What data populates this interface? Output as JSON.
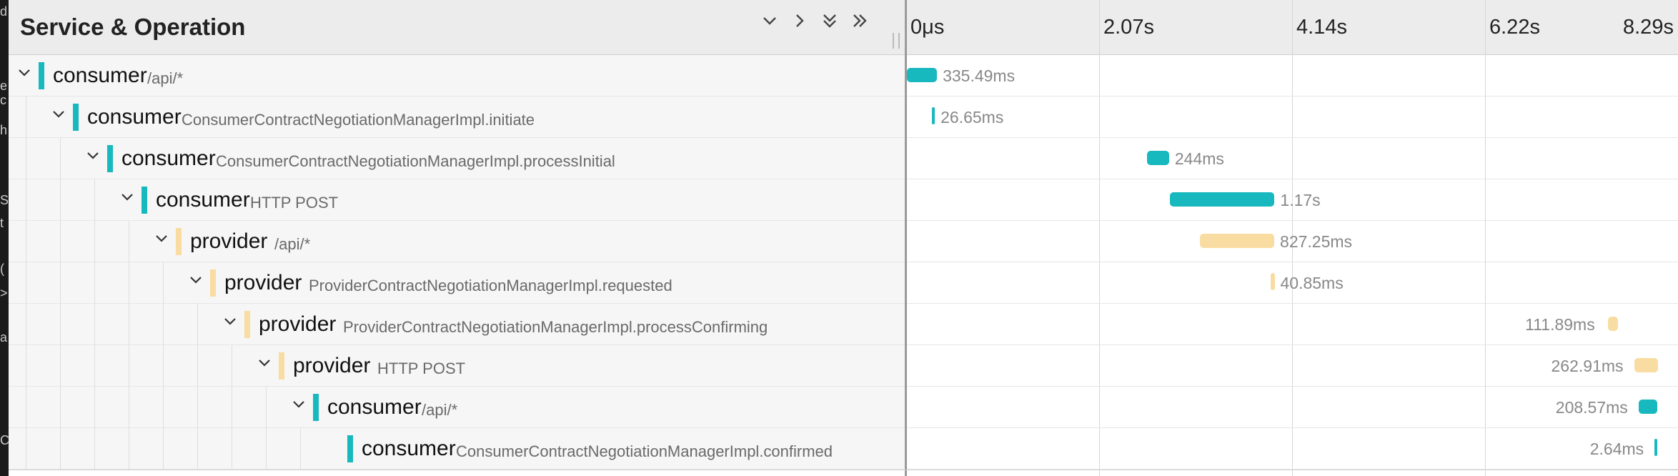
{
  "colors": {
    "consumer": "#17b8be",
    "provider": "#f8dca1",
    "header_bg": "#ececec"
  },
  "left_strip_glyphs": [
    "d",
    "e",
    "c",
    "h",
    "S",
    "t",
    "(",
    ">",
    "a",
    "C"
  ],
  "header": {
    "title": "Service & Operation",
    "controls": [
      {
        "name": "collapse-one-icon",
        "glyph": "⌄"
      },
      {
        "name": "expand-one-icon",
        "glyph": "›"
      },
      {
        "name": "expand-all-icon",
        "glyph": "⌄⌄"
      },
      {
        "name": "collapse-all-icon",
        "glyph": "»"
      }
    ]
  },
  "timeline": {
    "ticks": [
      "0μs",
      "2.07s",
      "4.14s",
      "6.22s",
      "8.29s"
    ],
    "max_seconds": 8.6
  },
  "spans": [
    {
      "service": "consumer",
      "operation": "/api/*",
      "depth": 0,
      "start_s": 0.0,
      "duration_s": 0.33549,
      "duration_label": "335.49ms",
      "expanded": true
    },
    {
      "service": "consumer",
      "operation": "ConsumerContractNegotiationManagerImpl.initiate",
      "depth": 1,
      "start_s": 0.28,
      "duration_s": 0.02665,
      "duration_label": "26.65ms",
      "expanded": true
    },
    {
      "service": "consumer",
      "operation": "ConsumerContractNegotiationManagerImpl.processInitial",
      "depth": 2,
      "start_s": 2.68,
      "duration_s": 0.244,
      "duration_label": "244ms",
      "expanded": true
    },
    {
      "service": "consumer",
      "operation": "HTTP POST",
      "depth": 3,
      "start_s": 2.93,
      "duration_s": 1.17,
      "duration_label": "1.17s",
      "expanded": true
    },
    {
      "service": "provider",
      "operation": "/api/*",
      "depth": 4,
      "start_s": 3.27,
      "duration_s": 0.82725,
      "duration_label": "827.25ms",
      "expanded": true
    },
    {
      "service": "provider",
      "operation": "ProviderContractNegotiationManagerImpl.requested",
      "depth": 5,
      "start_s": 4.06,
      "duration_s": 0.04085,
      "duration_label": "40.85ms",
      "expanded": true
    },
    {
      "service": "provider",
      "operation": "ProviderContractNegotiationManagerImpl.processConfirming",
      "depth": 6,
      "start_s": 7.82,
      "duration_s": 0.11189,
      "duration_label": "111.89ms",
      "expanded": true
    },
    {
      "service": "provider",
      "operation": "HTTP POST",
      "depth": 7,
      "start_s": 8.11,
      "duration_s": 0.26291,
      "duration_label": "262.91ms",
      "expanded": true
    },
    {
      "service": "consumer",
      "operation": "/api/*",
      "depth": 8,
      "start_s": 8.16,
      "duration_s": 0.20857,
      "duration_label": "208.57ms",
      "expanded": true
    },
    {
      "service": "consumer",
      "operation": "ConsumerContractNegotiationManagerImpl.confirmed",
      "depth": 9,
      "start_s": 8.335,
      "duration_s": 0.00264,
      "duration_label": "2.64ms",
      "expanded": false
    }
  ]
}
